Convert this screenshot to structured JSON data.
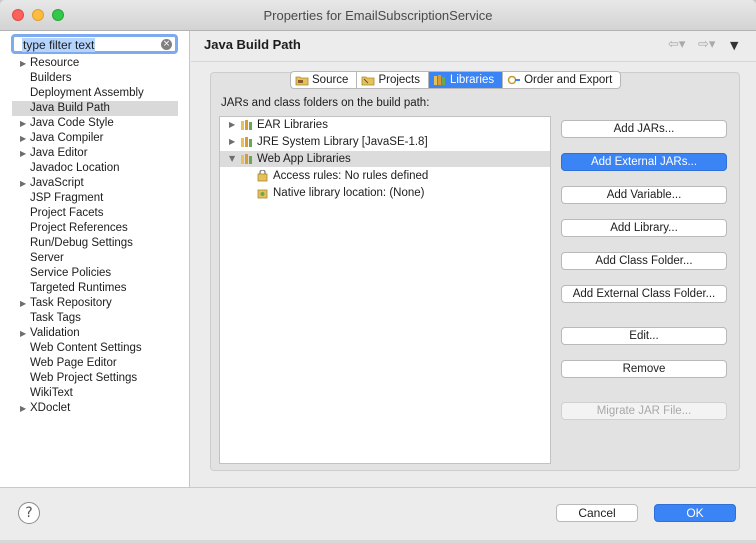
{
  "window": {
    "title": "Properties for EmailSubscriptionService"
  },
  "filter": {
    "value": "type filter text"
  },
  "sidebar": {
    "items": [
      {
        "label": "Resource",
        "expandable": true
      },
      {
        "label": "Builders",
        "expandable": false
      },
      {
        "label": "Deployment Assembly",
        "expandable": false
      },
      {
        "label": "Java Build Path",
        "expandable": false,
        "selected": true
      },
      {
        "label": "Java Code Style",
        "expandable": true
      },
      {
        "label": "Java Compiler",
        "expandable": true
      },
      {
        "label": "Java Editor",
        "expandable": true
      },
      {
        "label": "Javadoc Location",
        "expandable": false
      },
      {
        "label": "JavaScript",
        "expandable": true
      },
      {
        "label": "JSP Fragment",
        "expandable": false
      },
      {
        "label": "Project Facets",
        "expandable": false
      },
      {
        "label": "Project References",
        "expandable": false
      },
      {
        "label": "Run/Debug Settings",
        "expandable": false
      },
      {
        "label": "Server",
        "expandable": false
      },
      {
        "label": "Service Policies",
        "expandable": false
      },
      {
        "label": "Targeted Runtimes",
        "expandable": false
      },
      {
        "label": "Task Repository",
        "expandable": true
      },
      {
        "label": "Task Tags",
        "expandable": false
      },
      {
        "label": "Validation",
        "expandable": true
      },
      {
        "label": "Web Content Settings",
        "expandable": false
      },
      {
        "label": "Web Page Editor",
        "expandable": false
      },
      {
        "label": "Web Project Settings",
        "expandable": false
      },
      {
        "label": "WikiText",
        "expandable": false
      },
      {
        "label": "XDoclet",
        "expandable": true
      }
    ]
  },
  "header": {
    "title": "Java Build Path"
  },
  "tabs": [
    {
      "label": "Source",
      "active": false
    },
    {
      "label": "Projects",
      "active": false
    },
    {
      "label": "Libraries",
      "active": true
    },
    {
      "label": "Order and Export",
      "active": false
    }
  ],
  "jars": {
    "label": "JARs and class folders on the build path:",
    "rows": [
      {
        "label": "EAR Libraries",
        "twisty": "closed"
      },
      {
        "label": "JRE System Library [JavaSE-1.8]",
        "twisty": "closed"
      },
      {
        "label": "Web App Libraries",
        "twisty": "open",
        "selected": true
      },
      {
        "label": "Access rules: No rules defined",
        "twisty": "none"
      },
      {
        "label": "Native library location: (None)",
        "twisty": "none"
      }
    ]
  },
  "buttons": {
    "add_jars": "Add JARs...",
    "add_external_jars": "Add External JARs...",
    "add_variable": "Add Variable...",
    "add_library": "Add Library...",
    "add_class_folder": "Add Class Folder...",
    "add_external_class_folder": "Add External Class Folder...",
    "edit": "Edit...",
    "remove": "Remove",
    "migrate_jar": "Migrate JAR File..."
  },
  "footer": {
    "help": "?",
    "cancel": "Cancel",
    "ok": "OK"
  },
  "colors": {
    "accent": "#3a84f5",
    "selection": "#d9d9d9"
  }
}
